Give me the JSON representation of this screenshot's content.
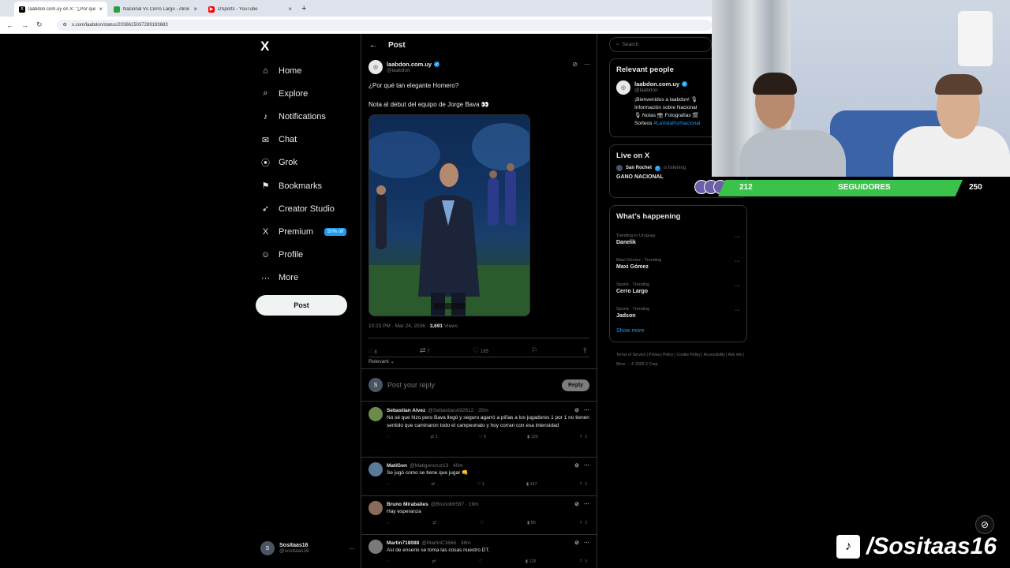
{
  "browser": {
    "tabs": [
      {
        "title": "laabdon.com.uy on X: \"¿Por qué",
        "fav_color": "#000000",
        "fav_glyph": "X",
        "active": true
      },
      {
        "title": "Nacional Vs Cerro Largo - Alinê",
        "fav_color": "#2e9e3a",
        "fav_glyph": "",
        "active": false
      },
      {
        "title": "DSports - YouTube",
        "fav_color": "#ff0000",
        "fav_glyph": "▶",
        "active": false
      }
    ],
    "new_tab": "+",
    "url": "x.com/laabdon/status/2036615037289193683"
  },
  "nav": {
    "logo": "X",
    "items": [
      {
        "label": "Home",
        "icon": "⌂",
        "dot": true
      },
      {
        "label": "Explore",
        "icon": "⌕",
        "dot": false
      },
      {
        "label": "Notifications",
        "icon": "♪",
        "dot": false
      },
      {
        "label": "Chat",
        "icon": "✉",
        "dot": false
      },
      {
        "label": "Grok",
        "icon": "⦿",
        "dot": true
      },
      {
        "label": "Bookmarks",
        "icon": "⚑",
        "dot": false
      },
      {
        "label": "Creator Studio",
        "icon": "➶",
        "dot": false
      },
      {
        "label": "Premium",
        "icon": "X",
        "dot": false,
        "badge": "50% off"
      },
      {
        "label": "Profile",
        "icon": "☺",
        "dot": false
      },
      {
        "label": "More",
        "icon": "⋯",
        "dot": false
      }
    ],
    "post_button": "Post",
    "account": {
      "name": "Sositaas16",
      "handle": "@sositaas16",
      "more": "···"
    }
  },
  "post": {
    "header": "Post",
    "back": "←",
    "author_name": "laabdon.com.uy",
    "author_handle": "@laabdon",
    "text1": "¿Por qué tan elegante Homero?",
    "text2": "Nota al debut del equipo de Jorge Bava 👀",
    "time": "10:23 PM · Mar 24, 2026 ·",
    "views_count": "3,691",
    "views_label": "Views",
    "stats": {
      "replies": "8",
      "reposts": "7",
      "likes": "165"
    },
    "relevant": "Relevant ⌄",
    "reply_placeholder": "Post your reply",
    "reply_button": "Reply"
  },
  "comments": [
    {
      "name": "Sebastian Alvez",
      "handle": "@SebastianA92612 · 35m",
      "text": "No sé que hizo pero Bava llegó y seguro agarró a piñas a los jugadores 1 por 1 no tienen sentido que caminaron todo el campeonato y hoy corran con esa intensidad",
      "reposts": "1",
      "likes": "5",
      "views": "120",
      "color": "#6d8a4b"
    },
    {
      "name": "MatiGon",
      "handle": "@Matigoncruz13 · 40m",
      "text": "Se jugó como se tiene que jugar 👊",
      "reposts": "",
      "likes": "1",
      "views": "147",
      "color": "#5a7a9a"
    },
    {
      "name": "Bruno Mirabalies",
      "handle": "@BrunoMr587 · 19m",
      "text": "Hay esperanza",
      "reposts": "",
      "likes": "",
      "views": "56",
      "color": "#8a6a5a"
    },
    {
      "name": "Martin718088",
      "handle": "@MartinC1666 · 38m",
      "text": "Así de enserio se toma las cosas nuestro DT.",
      "reposts": "",
      "likes": "",
      "views": "125",
      "color": "#7a7a7a"
    }
  ],
  "sidebar": {
    "search_placeholder": "Search",
    "relevant_title": "Relevant people",
    "rp_name": "laabdon.com.uy",
    "rp_handle": "@laabdon",
    "rp_bio1": "¡Bienvenidos a laabdon! 🎙",
    "rp_bio2": "Información sobre Nacional",
    "rp_bio3": "🎙 Notas 📸 Fotografías 🎬",
    "rp_bio4a": "Sorteos",
    "rp_bio4b": "#LaVidaPorNacional",
    "live_title": "Live on X",
    "live_user": "San Rochet",
    "live_status": "is listening",
    "live_name": "GANO NACIONAL",
    "happening_title": "What’s happening",
    "trends": [
      {
        "meta": "Trending in Uruguay",
        "name": "Danelik"
      },
      {
        "meta": "Maxi Gómez · Trending",
        "name": "Maxi Gómez"
      },
      {
        "meta": "Sports · Trending",
        "name": "Cerro Largo"
      },
      {
        "meta": "Sports · Trending",
        "name": "Jadson"
      }
    ],
    "show_more": "Show more",
    "footer": "Terms of Service  |  Privacy Policy  |  Cookie Policy  |  Accessibility  |  Ads info  |  More ···  © 2026 X Corp."
  },
  "overlay": {
    "followers_current": "212",
    "followers_label": "SEGUIDORES",
    "followers_goal": "250",
    "tiktok_handle": "/Sositaas16",
    "tiktok_icon": "♪"
  }
}
